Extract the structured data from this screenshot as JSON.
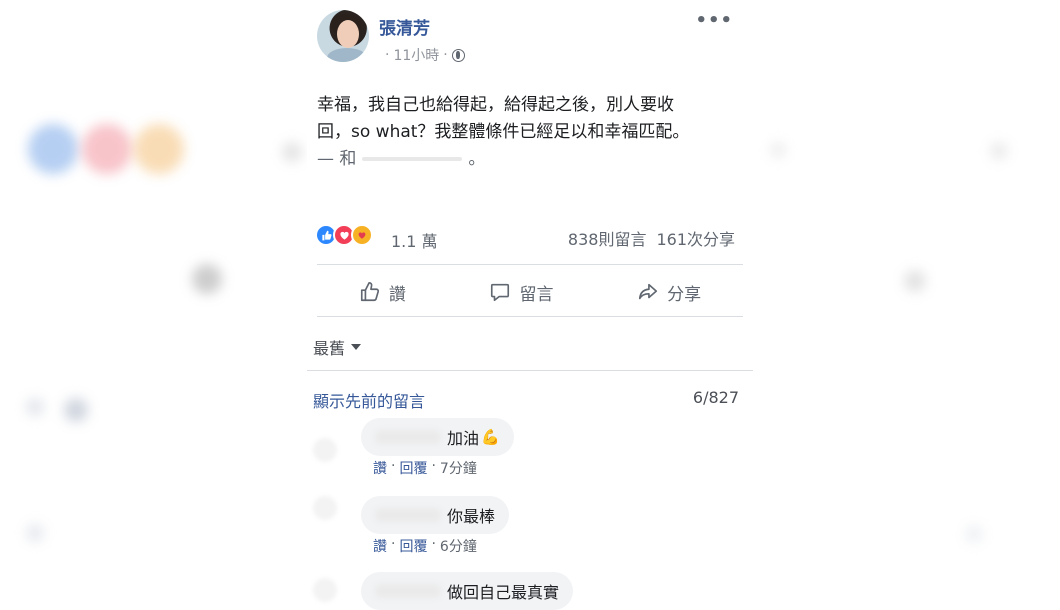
{
  "post": {
    "author": "張清芳",
    "time": "11小時",
    "separator": "·",
    "more_label": "•••",
    "text_line1": "幸福，我自己也給得起，給得起之後，別人要收",
    "text_line2": "回，so what？我整體條件已經足以和幸福匹配。",
    "text_line3_prefix": "— 和",
    "text_line3_suffix": "。",
    "reaction_count": "1.1 萬",
    "comments_stat": "838則留言",
    "shares_stat": "161次分享",
    "actions": {
      "like": "讚",
      "comment": "留言",
      "share": "分享"
    }
  },
  "comments_section": {
    "sort_label": "最舊",
    "view_previous": "顯示先前的留言",
    "count": "6/827",
    "items": [
      {
        "text": "加油",
        "like": "讚",
        "reply": "回覆",
        "time": "7分鐘"
      },
      {
        "text": "你最棒",
        "like": "讚",
        "reply": "回覆",
        "time": "6分鐘"
      },
      {
        "text": "做回自己最真實"
      }
    ]
  },
  "icons": {
    "like": "thumbs-up-icon",
    "comment": "speech-bubble-icon",
    "share": "share-arrow-icon",
    "privacy": "globe-icon",
    "reactions": [
      "like-reaction-icon",
      "love-reaction-icon",
      "care-reaction-icon"
    ]
  },
  "colors": {
    "link": "#365899",
    "like_reaction": "#2d88ff",
    "love_reaction": "#f33e58",
    "care_reaction": "#f7b125"
  }
}
